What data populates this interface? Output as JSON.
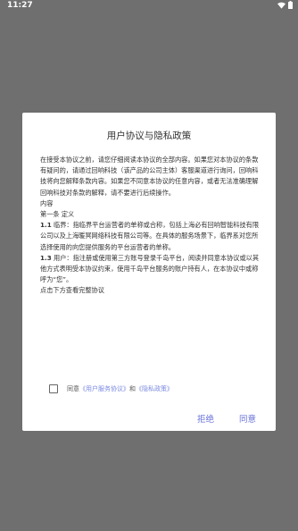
{
  "status_bar": {
    "time": "11:27"
  },
  "dialog": {
    "title": "用户协议与隐私政策",
    "intro": "在接受本协议之前，请您仔细阅读本协议的全部内容。如果您对本协议的条款有疑问的，请通过回响科技（该产品的公司主体）客服渠道进行询问，回响科技将向您解释条款内容。如果您不同意本协议的任意内容，或者无法准确理解回响科技对条款的解释，请不要进行后续操作。",
    "content_label": "内容",
    "article_1": "第一条 定义",
    "item_1_1_num": "1.1",
    "item_1_1_text": " 临界：指临界平台运营者的单称或合称，包括上海必有回响智能科技有限公司以及上海暖冥网络科技有限公司等。在具体的服务场景下，临界系对您所选择使用的向您提供服务的平台运营者的单称。",
    "item_1_3_num": "1.3",
    "item_1_3_text": " 用户：指注册或使用第三方账号登录千岛平台，阅读并同意本协议或以其他方式表明受本协议约束，使用千岛平台服务的账户持有人，在本协议中或称呼为“您”。",
    "click_hint": "点击下方查看完整协议",
    "agree_prefix": "同意",
    "agree_link_terms": "《用户服务协议》",
    "agree_and": "和",
    "agree_link_privacy": "《隐私政策》",
    "decline_label": "拒绝",
    "accept_label": "同意"
  },
  "colors": {
    "overlay": "#6f6f6f",
    "accent": "#6a72d8"
  }
}
